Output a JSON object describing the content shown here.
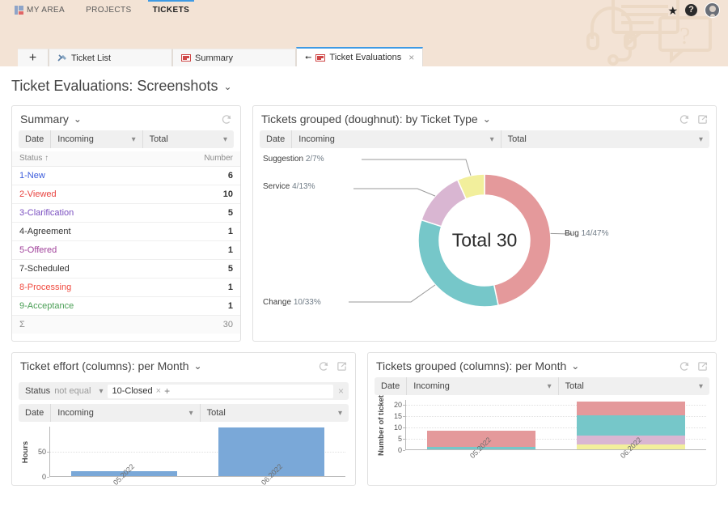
{
  "global_nav": {
    "items": [
      {
        "label": "MY AREA",
        "icon": "my-area-icon",
        "active": false
      },
      {
        "label": "PROJECTS",
        "icon": null,
        "active": false
      },
      {
        "label": "TICKETS",
        "icon": null,
        "active": true
      }
    ],
    "right_icons": [
      {
        "name": "favorites-star-icon",
        "glyph": "★"
      },
      {
        "name": "help-icon",
        "glyph": "?"
      },
      {
        "name": "user-avatar",
        "glyph": ""
      }
    ],
    "accent_color": "#3e9ae4",
    "background_color": "#f3e3d5"
  },
  "doc_tabs": {
    "new_tab_label": "+",
    "tabs": [
      {
        "label": "Ticket List",
        "icon": "tools-icon",
        "active": false,
        "closable": false
      },
      {
        "label": "Summary",
        "icon": "report-icon",
        "active": false,
        "closable": false
      },
      {
        "label": "Ticket Evaluations",
        "icon": "report-icon",
        "active": true,
        "closable": true,
        "pinned": true,
        "close_glyph": "×"
      }
    ]
  },
  "page": {
    "title": "Ticket Evaluations: Screenshots",
    "title_caret": "⌄"
  },
  "panels": {
    "summary": {
      "title": "Summary",
      "caret": "⌄",
      "actions": [
        {
          "name": "refresh-icon"
        }
      ],
      "selector": {
        "date_label": "Date",
        "incoming_label": "Incoming",
        "total_label": "Total"
      },
      "table": {
        "columns": [
          "Status ↑",
          "Number"
        ],
        "rows": [
          {
            "status": "1-New",
            "number": "6",
            "color": "#3b5bdb"
          },
          {
            "status": "2-Viewed",
            "number": "10",
            "color": "#e8423f"
          },
          {
            "status": "3-Clarification",
            "number": "5",
            "color": "#7a4fc0"
          },
          {
            "status": "4-Agreement",
            "number": "1",
            "color": "#333333"
          },
          {
            "status": "5-Offered",
            "number": "1",
            "color": "#a1429b"
          },
          {
            "status": "7-Scheduled",
            "number": "5",
            "color": "#333333"
          },
          {
            "status": "8-Processing",
            "number": "1",
            "color": "#f04a3f"
          },
          {
            "status": "9-Acceptance",
            "number": "1",
            "color": "#4a9e55"
          }
        ],
        "total_row": {
          "status": "Σ",
          "number": "30"
        }
      }
    },
    "doughnut": {
      "title": "Tickets grouped (doughnut): by Ticket Type",
      "caret": "⌄",
      "actions": [
        {
          "name": "refresh-icon"
        },
        {
          "name": "export-icon"
        }
      ],
      "selector": {
        "date_label": "Date",
        "incoming_label": "Incoming",
        "total_label": "Total"
      }
    },
    "effort": {
      "title": "Ticket effort (columns): per Month",
      "caret": "⌄",
      "actions": [
        {
          "name": "refresh-icon"
        },
        {
          "name": "export-icon"
        }
      ],
      "filter": {
        "field_label": "Status",
        "operator_label": "not equal",
        "chip_label": "10-Closed",
        "chip_remove_glyph": "×",
        "add_glyph": "+",
        "clear_glyph": "×"
      },
      "selector": {
        "date_label": "Date",
        "incoming_label": "Incoming",
        "total_label": "Total"
      }
    },
    "grouped_columns": {
      "title": "Tickets grouped (columns): per Month",
      "caret": "⌄",
      "actions": [
        {
          "name": "refresh-icon"
        },
        {
          "name": "export-icon"
        }
      ],
      "selector": {
        "date_label": "Date",
        "incoming_label": "Incoming",
        "total_label": "Total"
      }
    }
  },
  "chart_data": [
    {
      "id": "ticket-type-doughnut",
      "type": "pie",
      "title": "Tickets grouped (doughnut): by Ticket Type",
      "center_label": "Total 30",
      "total": 30,
      "legend_position": "callout-labels",
      "slices": [
        {
          "name": "Bug",
          "value": 14,
          "percent": 47,
          "label": "Bug 14/47%",
          "color": "#e4999b"
        },
        {
          "name": "Change",
          "value": 10,
          "percent": 33,
          "label": "Change 10/33%",
          "color": "#76c7c9"
        },
        {
          "name": "Service",
          "value": 4,
          "percent": 13,
          "label": "Service 4/13%",
          "color": "#d9b6d2"
        },
        {
          "name": "Suggestion",
          "value": 2,
          "percent": 7,
          "label": "Suggestion 2/7%",
          "color": "#f2ef9c"
        }
      ]
    },
    {
      "id": "ticket-effort-columns",
      "type": "bar",
      "title": "Ticket effort (columns): per Month",
      "categories": [
        "05.2022",
        "06.2022"
      ],
      "values": [
        10,
        97
      ],
      "xlabel": "",
      "ylabel": "Hours",
      "ylim": [
        0,
        100
      ],
      "yticks": [
        0,
        50
      ],
      "grid": true,
      "series_color": "#7aa8d8"
    },
    {
      "id": "tickets-grouped-columns",
      "type": "bar",
      "title": "Tickets grouped (columns): per Month",
      "categories": [
        "05.2022",
        "06.2022"
      ],
      "stacked": true,
      "xlabel": "",
      "ylabel": "Number of ticket",
      "ylim": [
        0,
        22
      ],
      "yticks": [
        0,
        5,
        10,
        15,
        20
      ],
      "grid": true,
      "series": [
        {
          "name": "Suggestion",
          "values": [
            0,
            2
          ],
          "color": "#f2ef9c"
        },
        {
          "name": "Service",
          "values": [
            0,
            4
          ],
          "color": "#d9b6d2"
        },
        {
          "name": "Change",
          "values": [
            1,
            9
          ],
          "color": "#76c7c9"
        },
        {
          "name": "Bug",
          "values": [
            7,
            6
          ],
          "color": "#e4999b"
        }
      ]
    }
  ]
}
